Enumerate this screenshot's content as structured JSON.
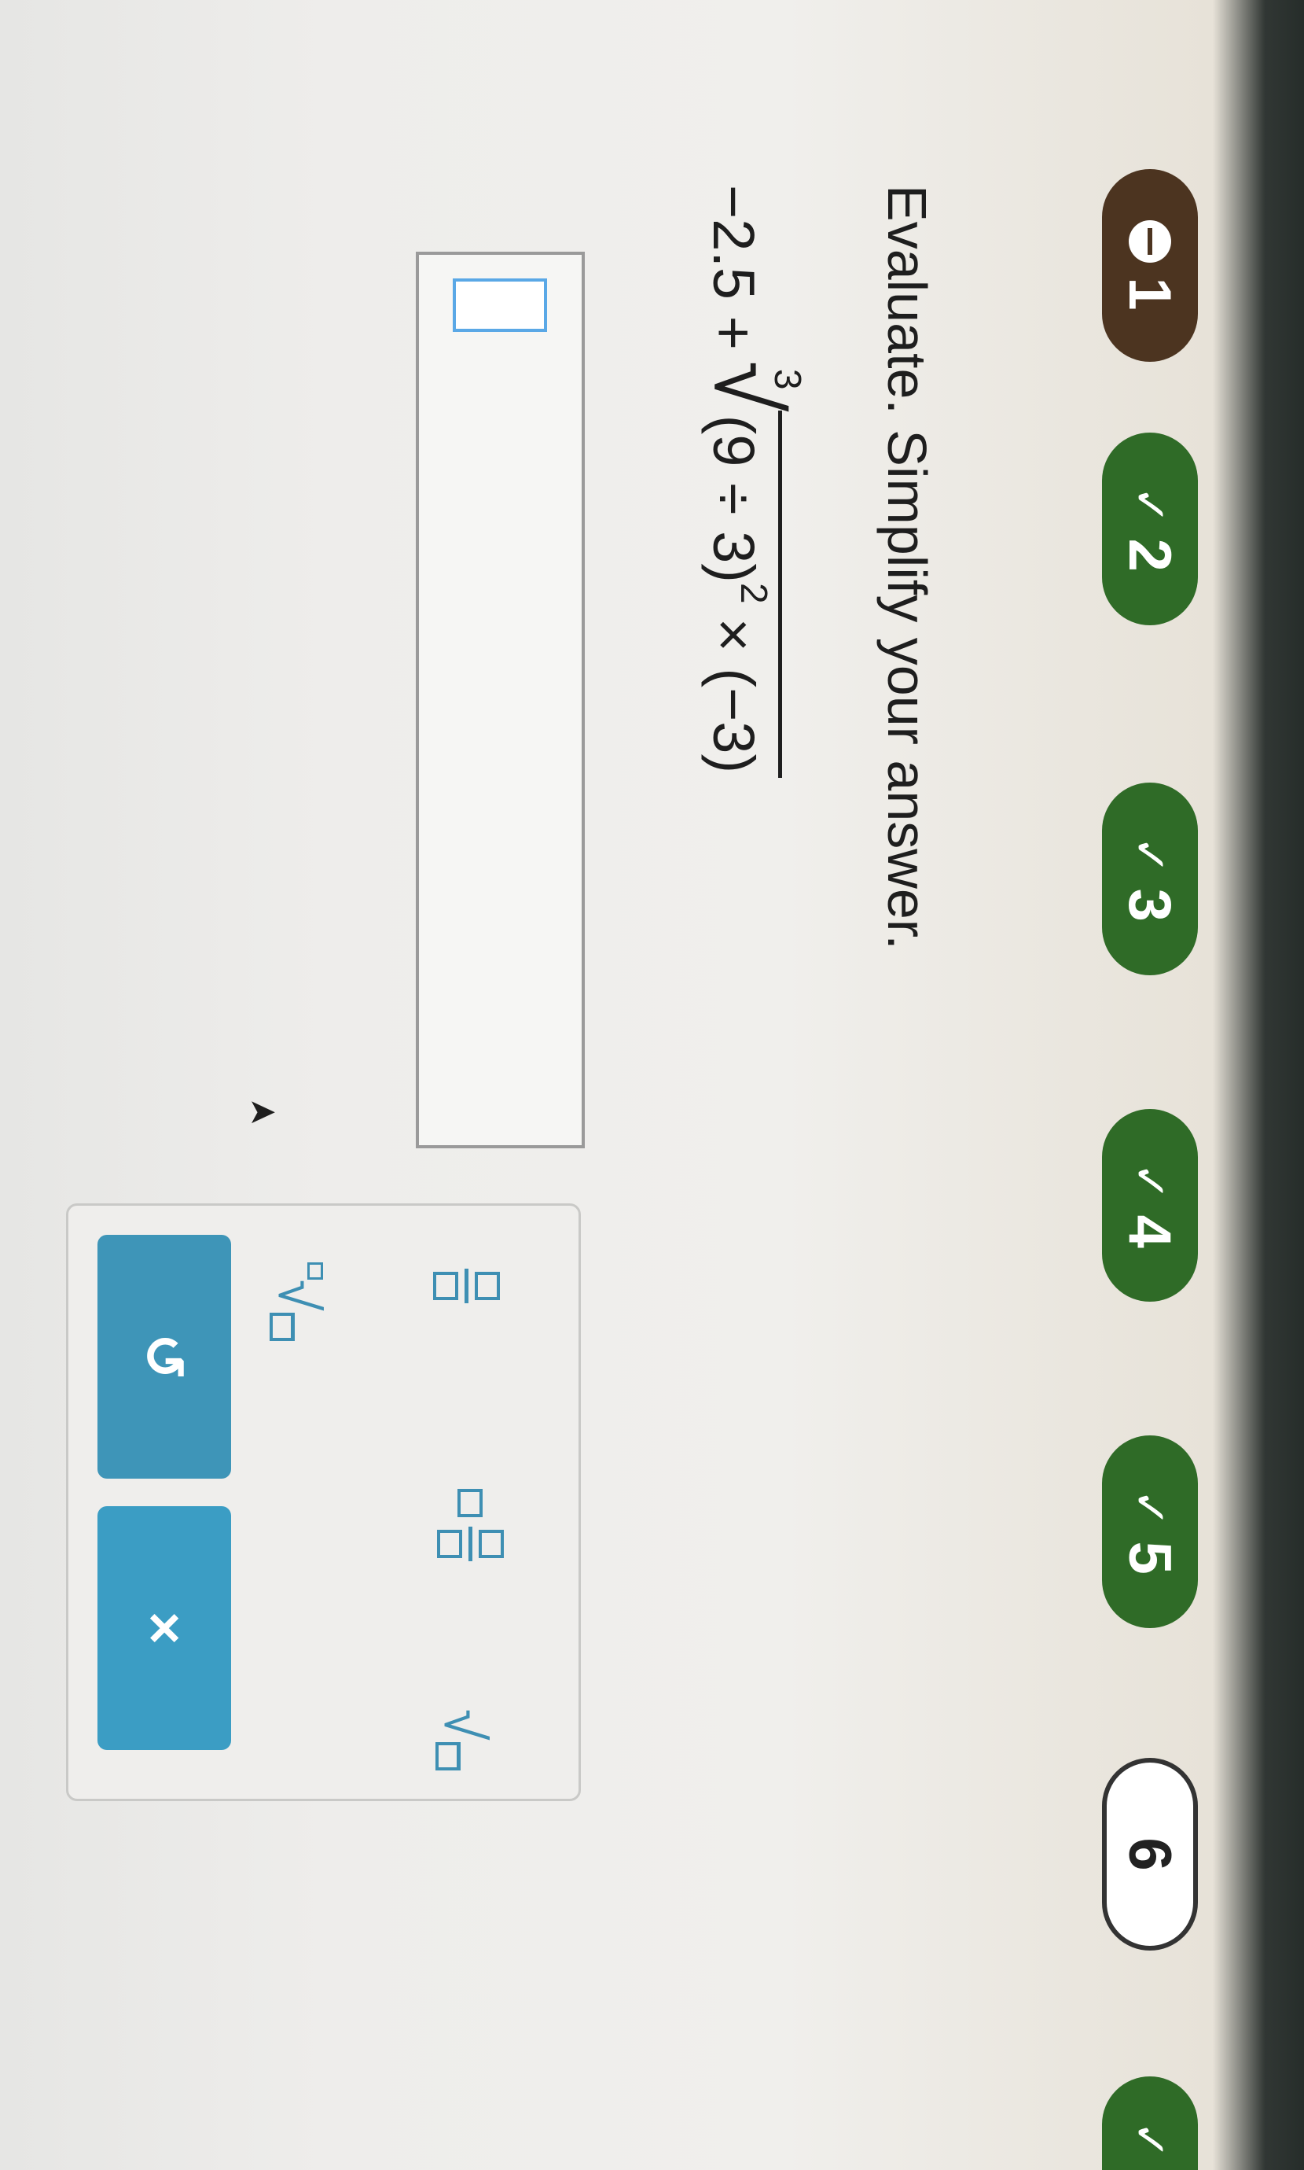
{
  "progress": {
    "steps": [
      {
        "number": "1",
        "state": "current",
        "icon": "circle-minus-icon"
      },
      {
        "number": "2",
        "state": "done",
        "icon": "check-icon"
      },
      {
        "number": "3",
        "state": "done",
        "icon": "check-icon"
      },
      {
        "number": "4",
        "state": "done",
        "icon": "check-icon"
      },
      {
        "number": "5",
        "state": "done",
        "icon": "check-icon"
      },
      {
        "number": "6",
        "state": "not-done",
        "icon": ""
      },
      {
        "number": "",
        "state": "done",
        "icon": "check-icon"
      }
    ],
    "check_symbol": "✓",
    "colors": {
      "done": "#2f6b27",
      "current": "#4c3420",
      "accent": "#3e95b8"
    }
  },
  "question": {
    "prompt": "Evaluate. Simplify your answer.",
    "expression": {
      "lead": "−2.5 +",
      "root_index": "3",
      "radical_sign": "√",
      "base": "(9 ÷ 3)",
      "exponent": "2",
      "tail": "× (−3)"
    }
  },
  "answer": {
    "value": ""
  },
  "keypad": {
    "sqrt_symbol": "√",
    "nthroot_symbol": "√",
    "undo_label": "↺",
    "clear_label": "×"
  }
}
